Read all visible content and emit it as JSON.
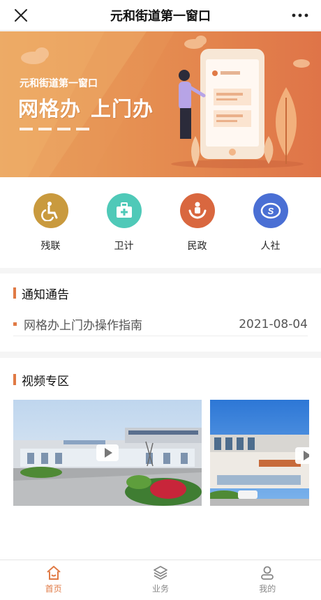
{
  "topbar": {
    "title": "元和街道第一窗口",
    "close_icon": "close-icon",
    "more_icon": "more-icon"
  },
  "banner": {
    "subtitle": "元和街道第一窗口",
    "headline_1": "网格办",
    "headline_2": "上门办",
    "phone_badge": "元和街道第一窗口"
  },
  "services": [
    {
      "label": "残联",
      "icon": "disability-icon",
      "color": "#c99a3e"
    },
    {
      "label": "卫计",
      "icon": "medical-kit-icon",
      "color": "#4fc9b8"
    },
    {
      "label": "民政",
      "icon": "civil-affairs-icon",
      "color": "#d9673f"
    },
    {
      "label": "人社",
      "icon": "social-security-icon",
      "color": "#4a6fd4"
    }
  ],
  "notice": {
    "title": "通知通告",
    "items": [
      {
        "title": "网格办上门办操作指南",
        "date": "2021-08-04"
      }
    ]
  },
  "video": {
    "title": "视频专区"
  },
  "tabbar": {
    "active_color": "#e07a45",
    "tabs": [
      {
        "label": "首页",
        "icon": "home-icon"
      },
      {
        "label": "业务",
        "icon": "layers-icon"
      },
      {
        "label": "我的",
        "icon": "user-icon"
      }
    ]
  }
}
